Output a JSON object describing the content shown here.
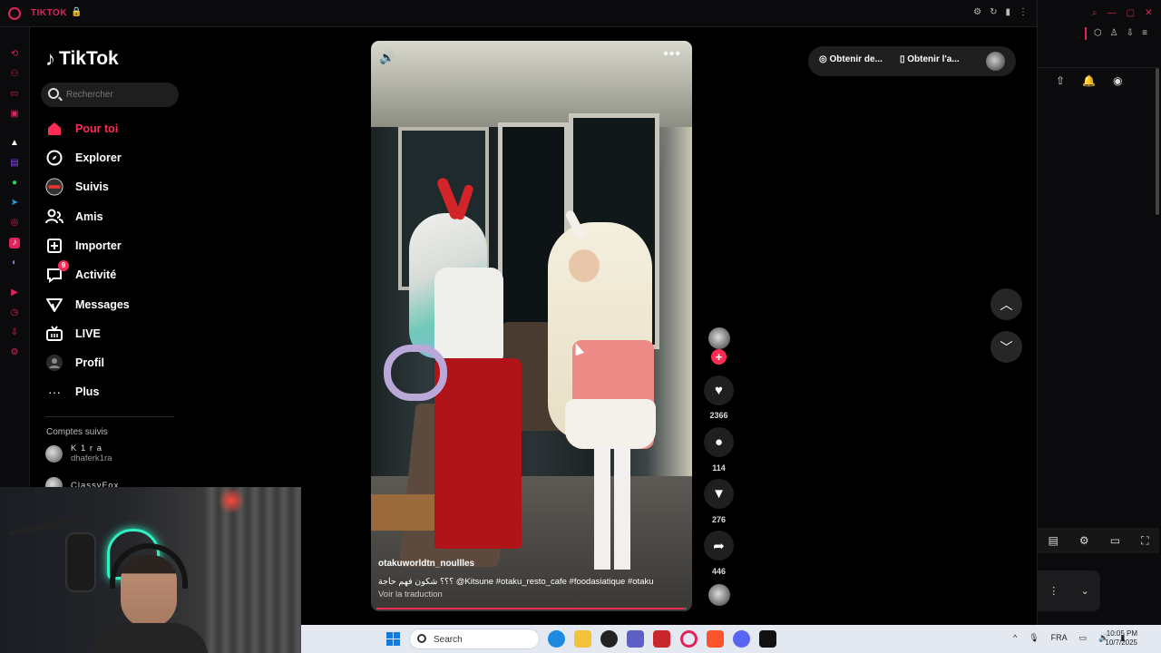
{
  "window": {
    "app_title": "TIKTOK",
    "lock_icon": "lock-icon"
  },
  "sidebar": {
    "brand": "TikTok",
    "search_placeholder": "Rechercher",
    "nav": [
      {
        "label": "Pour toi",
        "icon": "home-icon",
        "active": true
      },
      {
        "label": "Explorer",
        "icon": "compass-icon"
      },
      {
        "label": "Suivis",
        "icon": "following-avatar-icon"
      },
      {
        "label": "Amis",
        "icon": "friends-icon"
      },
      {
        "label": "Importer",
        "icon": "upload-plus-icon"
      },
      {
        "label": "Activité",
        "icon": "activity-icon",
        "badge": "9"
      },
      {
        "label": "Messages",
        "icon": "messages-icon"
      },
      {
        "label": "LIVE",
        "icon": "live-tv-icon"
      },
      {
        "label": "Profil",
        "icon": "profile-icon"
      },
      {
        "label": "Plus",
        "icon": "more-dots-icon"
      }
    ],
    "followed_title": "Comptes suivis",
    "followed": [
      {
        "name": "K 1 r a",
        "handle": "dhaferk1ra"
      },
      {
        "name": "ClassyFox",
        "handle": ""
      }
    ]
  },
  "video": {
    "author": "otakuworldtn_noullles",
    "caption": "؟؟؟ شكون فهم حاجة @Kitsune  #otaku_resto_cafe  #foodasiatique  #otaku",
    "translate": "Voir la traduction",
    "progress": 0.99
  },
  "actions": {
    "likes": "2366",
    "comments": "114",
    "saves": "276",
    "shares": "446"
  },
  "top_pill": {
    "btn1": "Obtenir de...",
    "btn2": "Obtenir l'a..."
  },
  "taskbar": {
    "search_placeholder": "Search",
    "language": "FRA",
    "time": "10:05 PM",
    "date": "10/7/2025"
  },
  "colors": {
    "accent": "#fe2c55",
    "opera_red": "#e0245e"
  }
}
